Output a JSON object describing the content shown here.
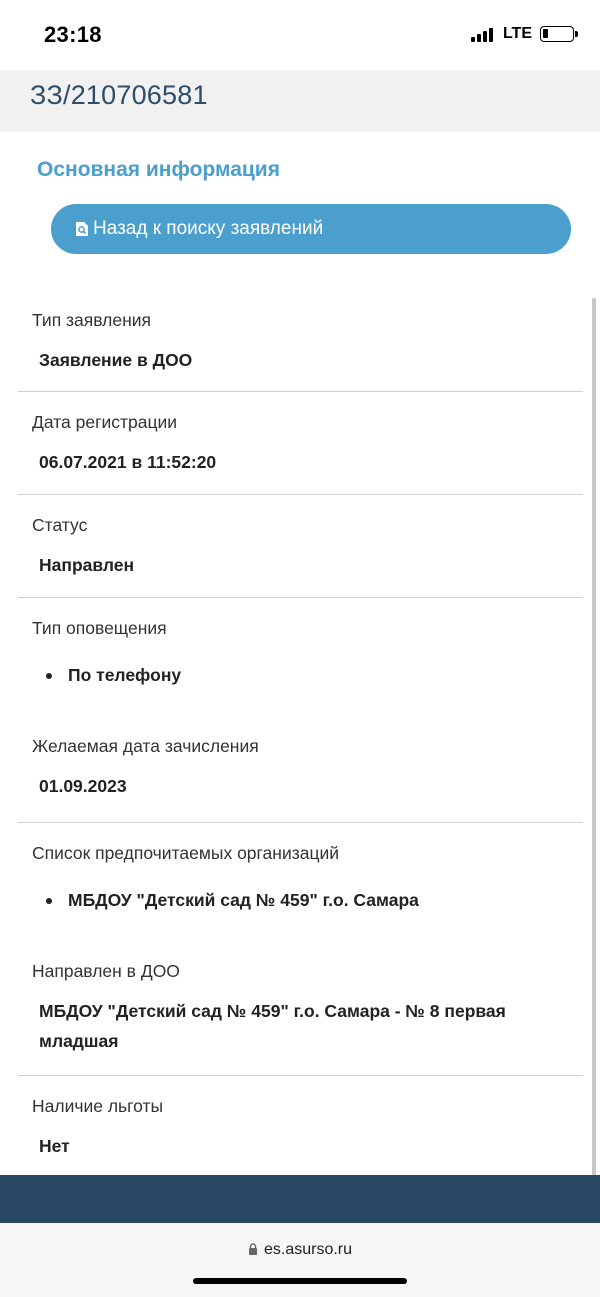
{
  "status_bar": {
    "time": "23:18",
    "network": "LTE"
  },
  "header": {
    "application_id": "ЗЗ/210706581"
  },
  "section": {
    "title": "Основная информация"
  },
  "back_button": {
    "label": "Назад к поиску заявлений",
    "icon": "document-search-icon"
  },
  "fields": {
    "type": {
      "label": "Тип заявления",
      "value": "Заявление в ДОО"
    },
    "reg_date": {
      "label": "Дата регистрации",
      "value": "06.07.2021 в 11:52:20"
    },
    "status": {
      "label": "Статус",
      "value": "Направлен"
    },
    "notification": {
      "label": "Тип оповещения",
      "items": [
        "По телефону"
      ]
    },
    "enroll_date": {
      "label": "Желаемая дата зачисления",
      "value": "01.09.2023"
    },
    "preferred_orgs": {
      "label": "Список предпочитаемых организаций",
      "items": [
        "МБДОУ \"Детский сад № 459\" г.о. Самара"
      ]
    },
    "directed_to": {
      "label": "Направлен в ДОО",
      "value": "МБДОУ \"Детский сад № 459\" г.о. Самара - № 8 первая младшая"
    },
    "benefit": {
      "label": "Наличие льготы",
      "value": "Нет"
    }
  },
  "browser": {
    "url": "es.asurso.ru"
  },
  "colors": {
    "accent": "#4a9fcd",
    "title_dark": "#2d4d68",
    "footer": "#284863"
  }
}
